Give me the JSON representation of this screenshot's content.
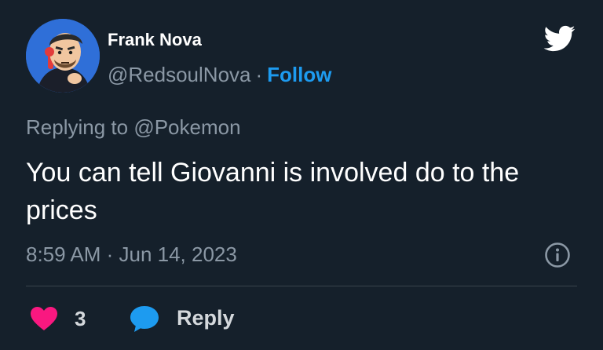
{
  "author": {
    "display_name": "Frank Nova",
    "handle": "@RedsoulNova",
    "separator": "·",
    "follow_label": "Follow"
  },
  "reply_context": {
    "prefix": "Replying to",
    "target": "@Pokemon"
  },
  "tweet": {
    "text": "You can tell Giovanni is involved do to the prices",
    "timestamp": "8:59 AM · Jun 14, 2023"
  },
  "actions": {
    "like_count": "3",
    "reply_label": "Reply"
  },
  "icons": {
    "brand": "twitter-bird-icon",
    "info": "info-icon",
    "like": "heart-icon",
    "reply": "speech-bubble-icon"
  },
  "colors": {
    "background": "#15202b",
    "accent": "#1d9bf0",
    "like": "#f91880",
    "muted_text": "#8b98a5"
  }
}
